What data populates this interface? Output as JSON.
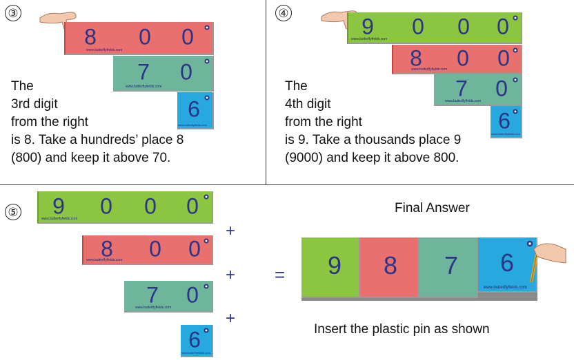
{
  "colors": {
    "red": "#e8706f",
    "teal": "#6fb59b",
    "blue": "#27a8df",
    "green": "#8cc540",
    "digit": "#2b3486"
  },
  "watermark": "www.butterflyfields.com",
  "step3": {
    "number": "③",
    "rows": [
      {
        "digits": [
          "8",
          "0",
          "0"
        ]
      },
      {
        "digits": [
          "7",
          "0"
        ]
      },
      {
        "digits": [
          "6"
        ]
      }
    ],
    "lines": [
      "The",
      "3rd digit",
      "from the right",
      "is 8. Take a hundreds’ place 8",
      "(800) and keep it above 70."
    ]
  },
  "step4": {
    "number": "④",
    "rows": [
      {
        "digits": [
          "9",
          "0",
          "0",
          "0"
        ]
      },
      {
        "digits": [
          "8",
          "0",
          "0"
        ]
      },
      {
        "digits": [
          "7",
          "0"
        ]
      },
      {
        "digits": [
          "6"
        ]
      }
    ],
    "lines": [
      "The",
      "4th digit",
      "from the right",
      "is 9. Take a thousands place 9",
      "(9000) and keep it above 800."
    ]
  },
  "step5": {
    "number": "⑤",
    "rows": [
      {
        "digits": [
          "9",
          "0",
          "0",
          "0"
        ]
      },
      {
        "digits": [
          "8",
          "0",
          "0"
        ]
      },
      {
        "digits": [
          "7",
          "0"
        ]
      },
      {
        "digits": [
          "6"
        ]
      }
    ],
    "plus": "+",
    "equals": "=",
    "final_title": "Final Answer",
    "final_digits": [
      "9",
      "8",
      "7",
      "6"
    ],
    "caption": "Insert the plastic pin as shown"
  }
}
